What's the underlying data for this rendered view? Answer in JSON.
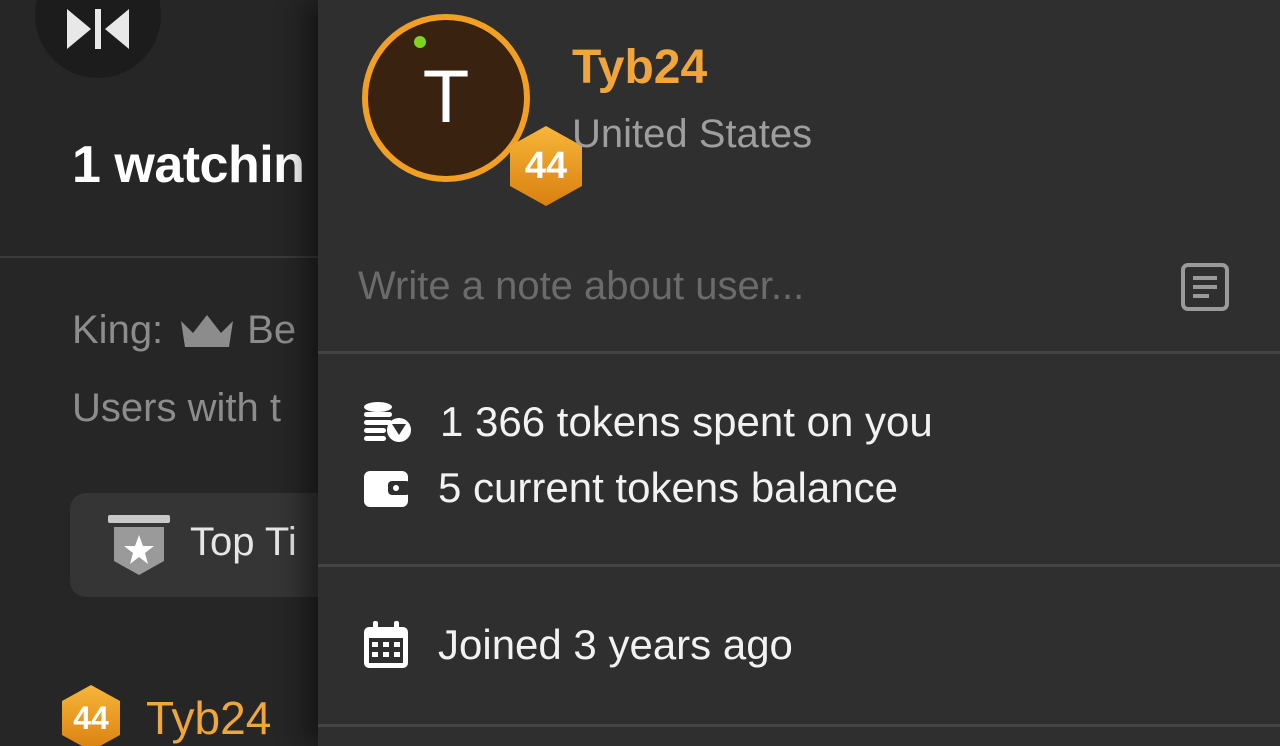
{
  "background_panel": {
    "logo_icon": "bowtie-play-logo-icon",
    "watching_text": "1 watchin",
    "king_label": "King:",
    "king_icon": "crown-icon",
    "king_value": "Be",
    "users_text": "Users with t",
    "top_tippers_label": "Top Ti",
    "top_tippers_icon": "shield-star-icon",
    "user_level": "44",
    "user_name": "Tyb24"
  },
  "profile_popup": {
    "avatar_letter": "T",
    "online_status_color": "#7ed321",
    "level": "44",
    "username": "Tyb24",
    "country": "United States",
    "note_placeholder": "Write a note about user...",
    "note_icon": "note-document-icon",
    "stats": [
      {
        "icon": "coins-icon",
        "text": "1 366 tokens spent on you"
      },
      {
        "icon": "wallet-icon",
        "text": "5 current tokens balance"
      }
    ],
    "joined": {
      "icon": "calendar-icon",
      "text": "Joined 3 years ago"
    }
  },
  "colors": {
    "accent": "#f0a63a",
    "avatar_ring": "#f2a024",
    "panel_bg": "#2f2f2f",
    "page_bg": "#262626"
  }
}
